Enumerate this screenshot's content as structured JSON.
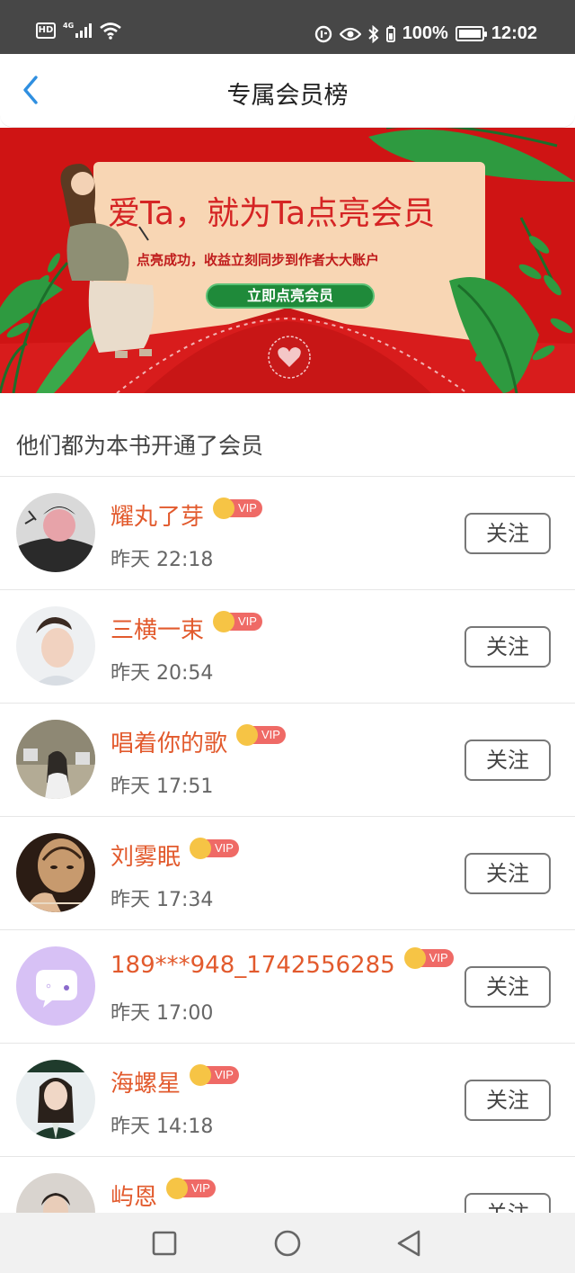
{
  "status_bar": {
    "hd": "HD",
    "network": "4G",
    "battery_percent": "100%",
    "time": "12:02"
  },
  "header": {
    "back_icon": "chevron-left-icon",
    "title": "专属会员榜"
  },
  "banner": {
    "headline": "爱Ta，就为Ta点亮会员",
    "subtitle": "点亮成功，收益立刻同步到作者大大账户",
    "button_label": "立即点亮会员"
  },
  "section": {
    "heading": "他们都为本书开通了会员"
  },
  "members": [
    {
      "name": "耀丸了芽",
      "badge": "VIP",
      "time": "昨天 22:18",
      "follow": "关注"
    },
    {
      "name": "三横一束",
      "badge": "VIP",
      "time": "昨天 20:54",
      "follow": "关注"
    },
    {
      "name": "唱着你的歌",
      "badge": "VIP",
      "time": "昨天 17:51",
      "follow": "关注"
    },
    {
      "name": "刘雾眠",
      "badge": "VIP",
      "time": "昨天 17:34",
      "follow": "关注"
    },
    {
      "name": "189***948_1742556285",
      "badge": "VIP",
      "time": "昨天 17:00",
      "follow": "关注"
    },
    {
      "name": "海螺星",
      "badge": "VIP",
      "time": "昨天 14:18",
      "follow": "关注"
    },
    {
      "name": "屿恩",
      "badge": "VIP",
      "time": "",
      "follow": "关注"
    }
  ],
  "nav_bar": {
    "icons": [
      "square-recents-icon",
      "circle-home-icon",
      "triangle-back-icon"
    ]
  },
  "colors": {
    "accent_blue": "#2f8fe0",
    "name_orange": "#e25a2d",
    "banner_red": "#cf1414",
    "vip_pink": "#ef6a66",
    "vip_gold": "#f6c445"
  }
}
